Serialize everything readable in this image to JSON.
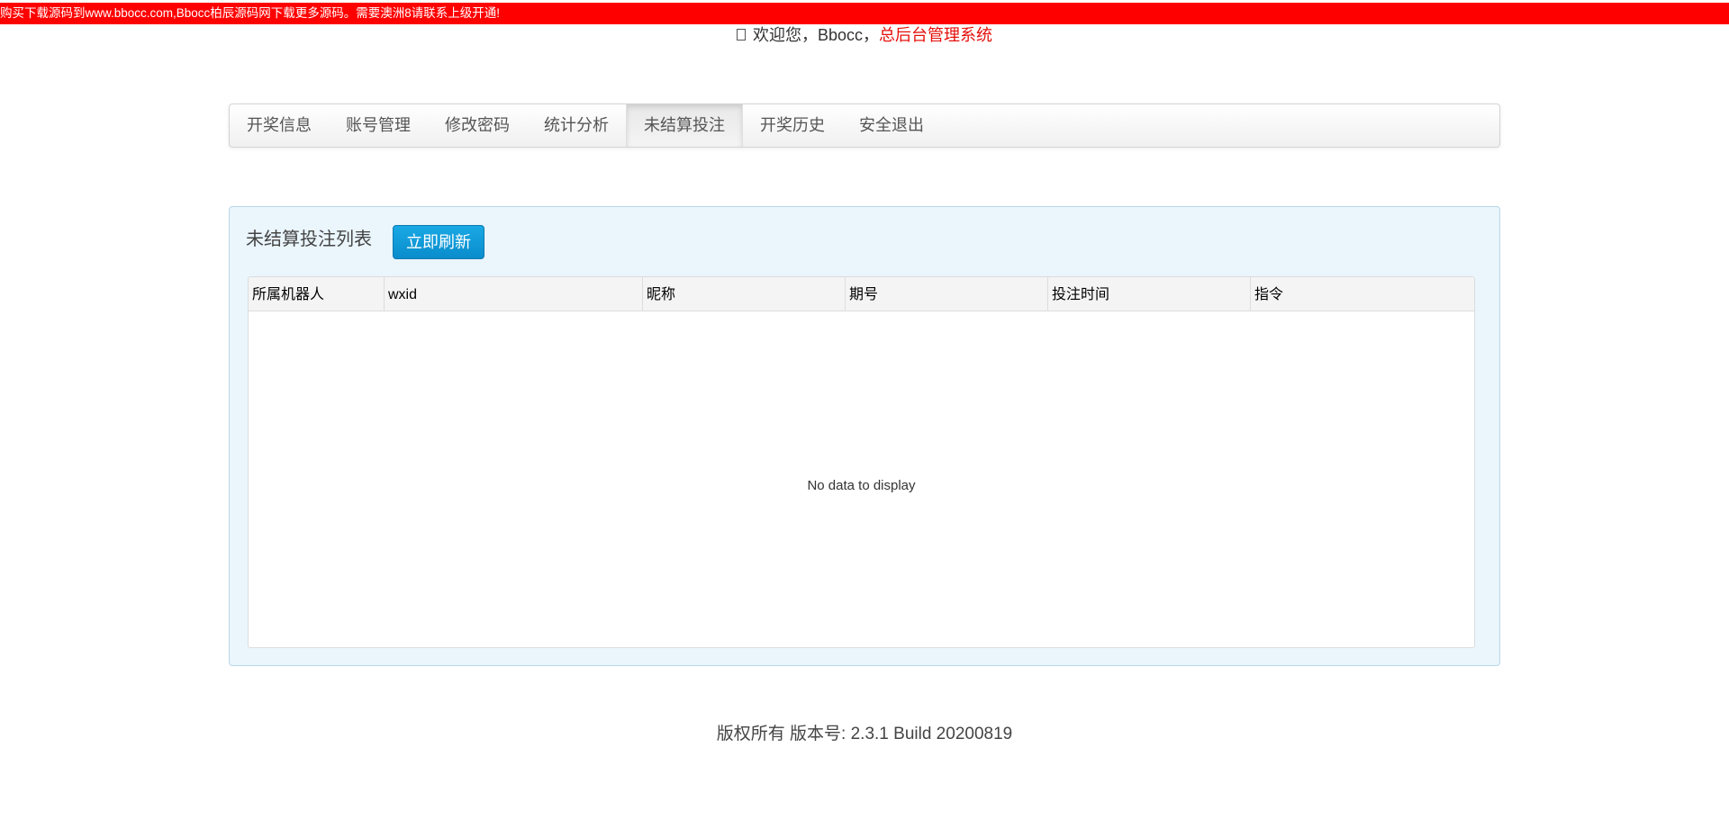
{
  "banner": {
    "text": "购买下载源码到www.bbocc.com,Bbocc柏辰源码网下载更多源码。需要澳洲8请联系上级开通!"
  },
  "header": {
    "user_icon": "user-icon",
    "welcome_text": "欢迎您，Bbocc，",
    "system_name": "总后台管理系统"
  },
  "nav": {
    "items": [
      {
        "label": "开奖信息"
      },
      {
        "label": "账号管理"
      },
      {
        "label": "修改密码"
      },
      {
        "label": "统计分析"
      },
      {
        "label": "未结算投注"
      },
      {
        "label": "开奖历史"
      },
      {
        "label": "安全退出"
      }
    ],
    "active_index": 4
  },
  "panel": {
    "title": "未结算投注列表",
    "refresh_label": "立即刷新",
    "columns": [
      {
        "label": "所属机器人"
      },
      {
        "label": "wxid"
      },
      {
        "label": "昵称"
      },
      {
        "label": "期号"
      },
      {
        "label": "投注时间"
      },
      {
        "label": "指令"
      }
    ],
    "rows": [],
    "empty_message": "No data to display"
  },
  "footer": {
    "text": "版权所有 版本号: 2.3.1 Build 20200819"
  },
  "colors": {
    "banner_bg": "#ff0000",
    "system_name": "#e4100c",
    "refresh_button": "#0f9ad9",
    "panel_bg": "#eaf5fc"
  }
}
